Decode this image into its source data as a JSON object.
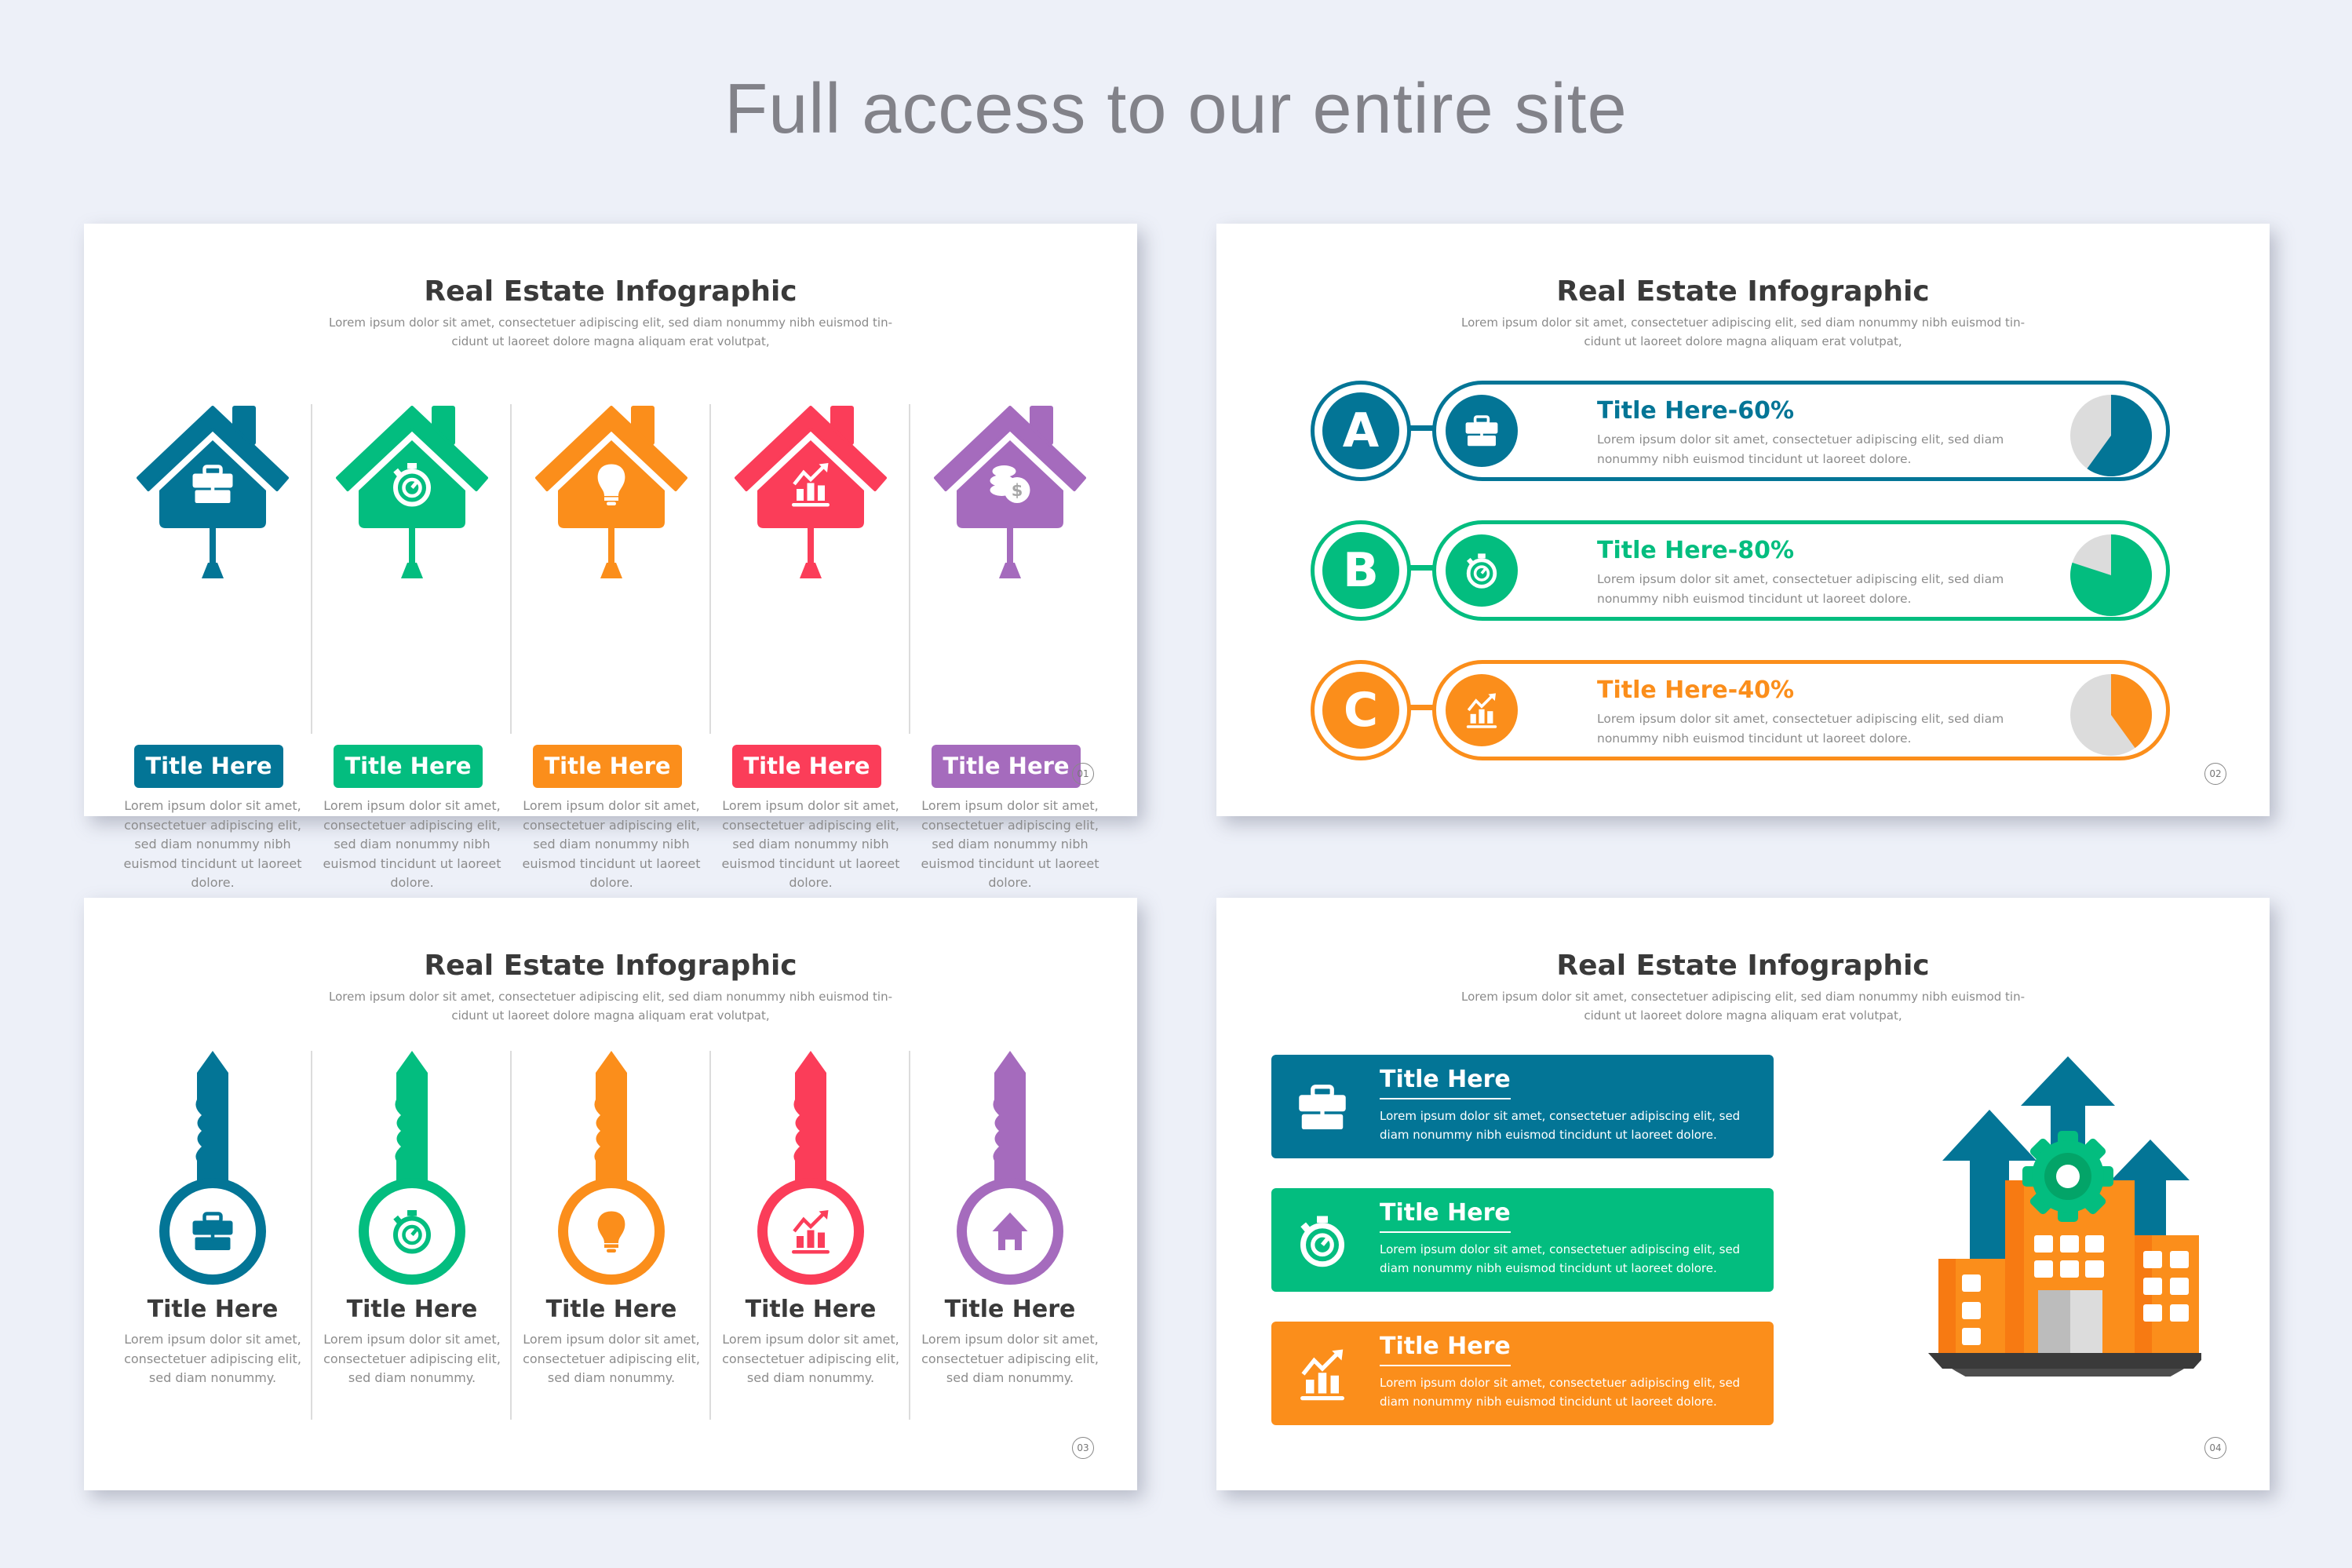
{
  "headline": "Full access to our entire site",
  "colors": {
    "blue": "#037596",
    "green": "#03bd7f",
    "orange": "#fb8e1b",
    "red": "#fb3d59",
    "purple": "#a56bbd",
    "pie_rest": "#dcdcdc",
    "background": "#edf0f8"
  },
  "slides": [
    {
      "title": "Real Estate Infographic",
      "subtitle": "Lorem ipsum dolor sit amet, consectetuer adipiscing elit, sed diam nonummy nibh euismod tin- cidunt ut laoreet dolore magna aliquam erat volutpat,",
      "page_number": "01",
      "items": [
        {
          "label": "Title Here",
          "icon": "briefcase-icon",
          "description": "Lorem ipsum dolor sit amet, consectetuer adipiscing elit, sed diam nonummy nibh euismod tincidunt ut laoreet dolore."
        },
        {
          "label": "Title Here",
          "icon": "stopwatch-icon",
          "description": "Lorem ipsum dolor sit amet, consectetuer adipiscing elit, sed diam nonummy nibh euismod tincidunt ut laoreet dolore."
        },
        {
          "label": "Title Here",
          "icon": "lightbulb-icon",
          "description": "Lorem ipsum dolor sit amet, consectetuer adipiscing elit, sed diam nonummy nibh euismod tincidunt ut laoreet dolore."
        },
        {
          "label": "Title Here",
          "icon": "growth-chart-icon",
          "description": "Lorem ipsum dolor sit amet, consectetuer adipiscing elit, sed diam nonummy nibh euismod tincidunt ut laoreet dolore."
        },
        {
          "label": "Title Here",
          "icon": "coins-dollar-icon",
          "description": "Lorem ipsum dolor sit amet, consectetuer adipiscing elit, sed diam nonummy nibh euismod tincidunt ut laoreet dolore."
        }
      ]
    },
    {
      "title": "Real Estate Infographic",
      "subtitle": "Lorem ipsum dolor sit amet, consectetuer adipiscing elit, sed diam nonummy nibh euismod tin- cidunt ut laoreet dolore magna aliquam erat volutpat,",
      "page_number": "02",
      "items": [
        {
          "letter": "A",
          "title": "Title Here-60%",
          "percent": 60,
          "icon": "briefcase-icon",
          "description": "Lorem ipsum dolor sit amet, consectetuer adipiscing elit, sed diam nonummy nibh euismod tincidunt ut laoreet dolore."
        },
        {
          "letter": "B",
          "title": "Title Here-80%",
          "percent": 80,
          "icon": "stopwatch-icon",
          "description": "Lorem ipsum dolor sit amet, consectetuer adipiscing elit, sed diam nonummy nibh euismod tincidunt ut laoreet dolore."
        },
        {
          "letter": "C",
          "title": "Title Here-40%",
          "percent": 40,
          "icon": "growth-chart-icon",
          "description": "Lorem ipsum dolor sit amet, consectetuer adipiscing elit, sed diam nonummy nibh euismod tincidunt ut laoreet dolore."
        }
      ]
    },
    {
      "title": "Real Estate Infographic",
      "subtitle": "Lorem ipsum dolor sit amet, consectetuer adipiscing elit, sed diam nonummy nibh euismod tin- cidunt ut laoreet dolore magna aliquam erat volutpat,",
      "page_number": "03",
      "items": [
        {
          "label": "Title Here",
          "icon": "briefcase-icon",
          "description": "Lorem ipsum dolor sit amet, consectetuer adipiscing elit, sed diam nonummy."
        },
        {
          "label": "Title Here",
          "icon": "stopwatch-icon",
          "description": "Lorem ipsum dolor sit amet, consectetuer adipiscing elit, sed diam nonummy."
        },
        {
          "label": "Title Here",
          "icon": "lightbulb-icon",
          "description": "Lorem ipsum dolor sit amet, consectetuer adipiscing elit, sed diam nonummy."
        },
        {
          "label": "Title Here",
          "icon": "growth-chart-icon",
          "description": "Lorem ipsum dolor sit amet, consectetuer adipiscing elit, sed diam nonummy."
        },
        {
          "label": "Title Here",
          "icon": "house-icon",
          "description": "Lorem ipsum dolor sit amet, consectetuer adipiscing elit, sed diam nonummy."
        }
      ]
    },
    {
      "title": "Real Estate Infographic",
      "subtitle": "Lorem ipsum dolor sit amet, consectetuer adipiscing elit, sed diam nonummy nibh euismod tin- cidunt ut laoreet dolore magna aliquam erat volutpat,",
      "page_number": "04",
      "items": [
        {
          "title": "Title Here",
          "icon": "briefcase-icon",
          "description": "Lorem ipsum dolor sit amet, consectetuer adipiscing elit, sed diam nonummy nibh euismod tincidunt ut laoreet dolore."
        },
        {
          "title": "Title Here",
          "icon": "stopwatch-icon",
          "description": "Lorem ipsum dolor sit amet, consectetuer adipiscing elit, sed diam nonummy nibh euismod tincidunt ut laoreet dolore."
        },
        {
          "title": "Title Here",
          "icon": "growth-chart-icon",
          "description": "Lorem ipsum dolor sit amet, consectetuer adipiscing elit, sed diam nonummy nibh euismod tincidunt ut laoreet dolore."
        }
      ],
      "illustration": "city-growth-gear-illustration"
    }
  ]
}
